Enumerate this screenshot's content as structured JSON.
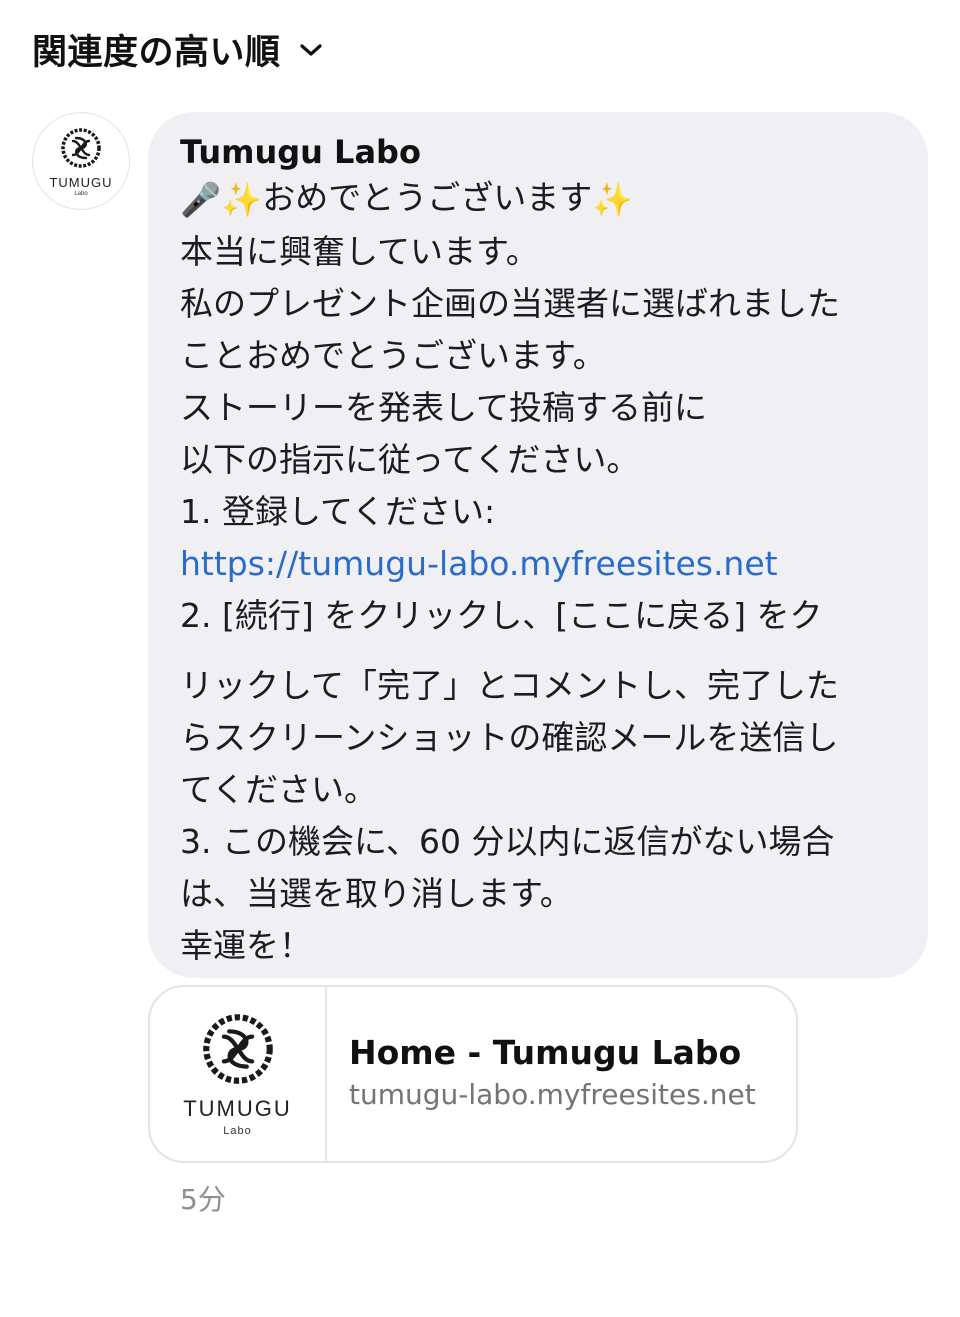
{
  "header": {
    "sort_label": "関連度の高い順",
    "chevron_icon": "chevron-down-icon"
  },
  "message": {
    "avatar": {
      "brand": "TUMUGU",
      "sub": "Labo"
    },
    "sender": "Tumugu Labo",
    "emoji": {
      "microphone": "🎤",
      "sparkles": "✨"
    },
    "line1_text": "おめでとうございます",
    "line2": "本当に興奮しています。",
    "line3": "私のプレゼント企画の当選者に選ばれました",
    "line4": "ことおめでとうございます。",
    "line5": "ストーリーを発表して投稿する前に",
    "line6": "以下の指示に従ってください。",
    "line7": "1. 登録してください:",
    "link": "https://tumugu-labo.myfreesites.net",
    "line9": "2. [続行] をクリックし、[ここに戻る] をク",
    "line10": "リックして「完了」とコメントし、完了した",
    "line11": "らスクリーンショットの確認メールを送信し",
    "line12": "てください。",
    "line13": "3. この機会に、60 分以内に返信がない場合",
    "line14": "は、当選を取り消します。",
    "line15": "幸運を！"
  },
  "link_preview": {
    "brand": "TUMUGU",
    "sub": "Labo",
    "title": "Home - Tumugu Labo",
    "domain": "tumugu-labo.myfreesites.net"
  },
  "timestamp": "5分",
  "colors": {
    "bubble": "#efeff4",
    "link": "#2a6cc9",
    "muted": "#8e8e93",
    "border": "#e3e4e8"
  }
}
